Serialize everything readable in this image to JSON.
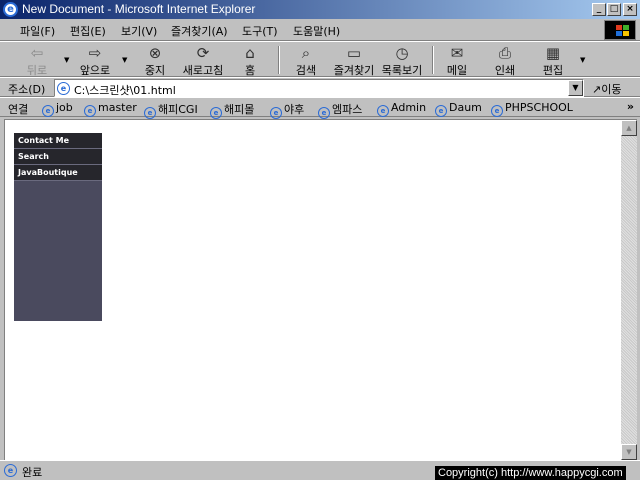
{
  "window": {
    "title": "New Document - Microsoft Internet Explorer"
  },
  "menu": [
    "파일(F)",
    "편집(E)",
    "보기(V)",
    "즐겨찾기(A)",
    "도구(T)",
    "도움말(H)"
  ],
  "toolbar": {
    "back": "뒤로",
    "forward": "앞으로",
    "stop": "중지",
    "refresh": "새로고침",
    "home": "홈",
    "search": "검색",
    "favorites": "즐겨찾기",
    "history": "목록보기",
    "mail": "메일",
    "print": "인쇄",
    "edit": "편집"
  },
  "address": {
    "label": "주소(D)",
    "value": "C:\\스크린샷\\01.html",
    "go": "이동"
  },
  "links": {
    "label": "연결",
    "items": [
      "job",
      "master",
      "해피CGI",
      "해피몰",
      "야후",
      "엠파스",
      "Admin",
      "Daum",
      "PHPSCHOOL"
    ]
  },
  "page": {
    "nav": [
      "Contact Me",
      "Search",
      "JavaBoutique"
    ]
  },
  "status": {
    "text": "완료",
    "copyright": "Copyright(c) http://www.happycgi.com"
  }
}
